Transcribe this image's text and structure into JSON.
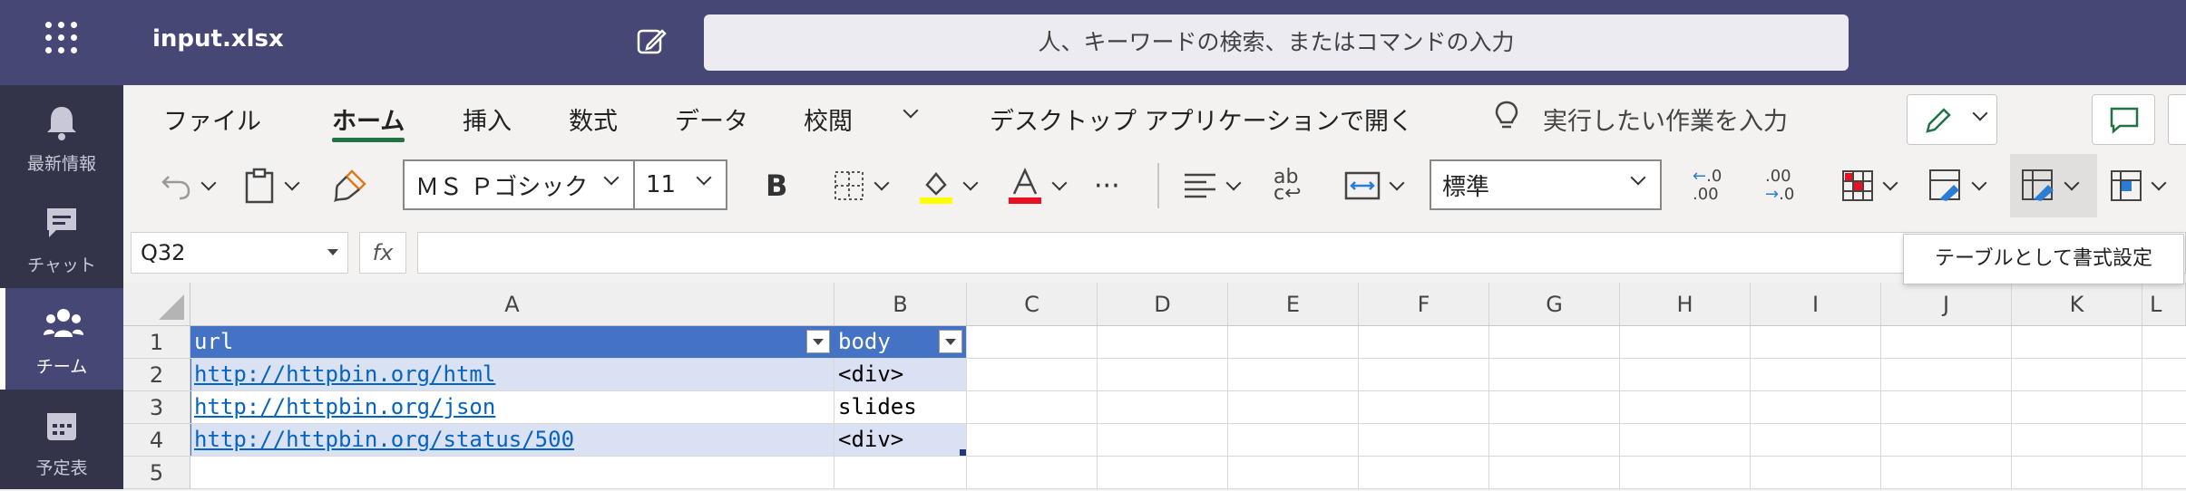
{
  "app": {
    "title": "input.xlsx",
    "search_placeholder": "人、キーワードの検索、またはコマンドの入力",
    "brand_color": "#464775"
  },
  "rail": [
    {
      "label": "最新情報",
      "icon": "bell-icon"
    },
    {
      "label": "チャット",
      "icon": "chat-icon"
    },
    {
      "label": "チーム",
      "icon": "teams-icon",
      "active": true
    },
    {
      "label": "予定表",
      "icon": "calendar-icon"
    }
  ],
  "ribbon": {
    "tabs": [
      "ファイル",
      "ホーム",
      "挿入",
      "数式",
      "データ",
      "校閲"
    ],
    "active_tab": "ホーム",
    "open_desktop": "デスクトップ アプリケーションで開く",
    "tell_me": "実行したい作業を入力",
    "font_name": "ＭＳ Ｐゴシック",
    "font_size": "11",
    "number_format": "標準",
    "accent_color": "#217346"
  },
  "formula_bar": {
    "name_box": "Q32",
    "fx_label": "fx",
    "formula": ""
  },
  "tooltip": "テーブルとして書式設定",
  "sheet": {
    "columns": [
      "A",
      "B",
      "C",
      "D",
      "E",
      "F",
      "G",
      "H",
      "I",
      "J",
      "K",
      "L"
    ],
    "rows": [
      "1",
      "2",
      "3",
      "4",
      "5"
    ],
    "table": {
      "header": [
        "url",
        "body"
      ],
      "body": [
        [
          "http://httpbin.org/html",
          "<div>"
        ],
        [
          "http://httpbin.org/json",
          "slides"
        ],
        [
          "http://httpbin.org/status/500",
          "<div>"
        ]
      ]
    },
    "table_header_color": "#4472c4",
    "table_band_color": "#d9e1f2"
  }
}
